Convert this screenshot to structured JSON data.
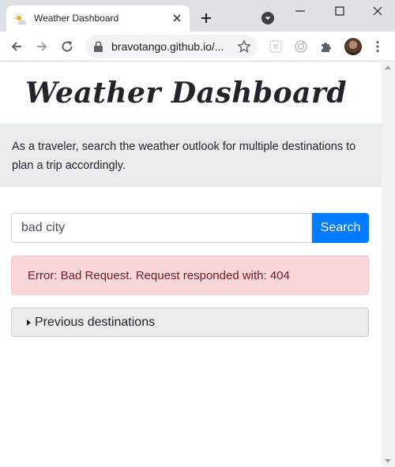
{
  "browser": {
    "tab_title": "Weather Dashboard",
    "url": "bravotango.github.io/...",
    "icons": [
      "weather-favicon-icon",
      "close-icon",
      "plus-icon",
      "tab-search-icon",
      "minimize-icon",
      "maximize-icon",
      "window-close-icon",
      "back-icon",
      "forward-icon",
      "reload-icon",
      "lock-icon",
      "star-icon",
      "extension-icon",
      "puzzle-icon",
      "kebab-menu-icon"
    ]
  },
  "header": {
    "title": "Weather Dashboard"
  },
  "intro": {
    "text": "As a traveler, search the weather outlook for multiple destinations to plan a trip accordingly."
  },
  "search": {
    "value": "bad city",
    "button_label": "Search"
  },
  "alert": {
    "message": "Error: Bad Request. Request responded with: 404"
  },
  "history": {
    "label": "Previous destinations"
  },
  "colors": {
    "primary": "#007bff",
    "alert_bg": "#f8d7da",
    "alert_text": "#721c24",
    "jumbotron_bg": "#e9ecef"
  }
}
